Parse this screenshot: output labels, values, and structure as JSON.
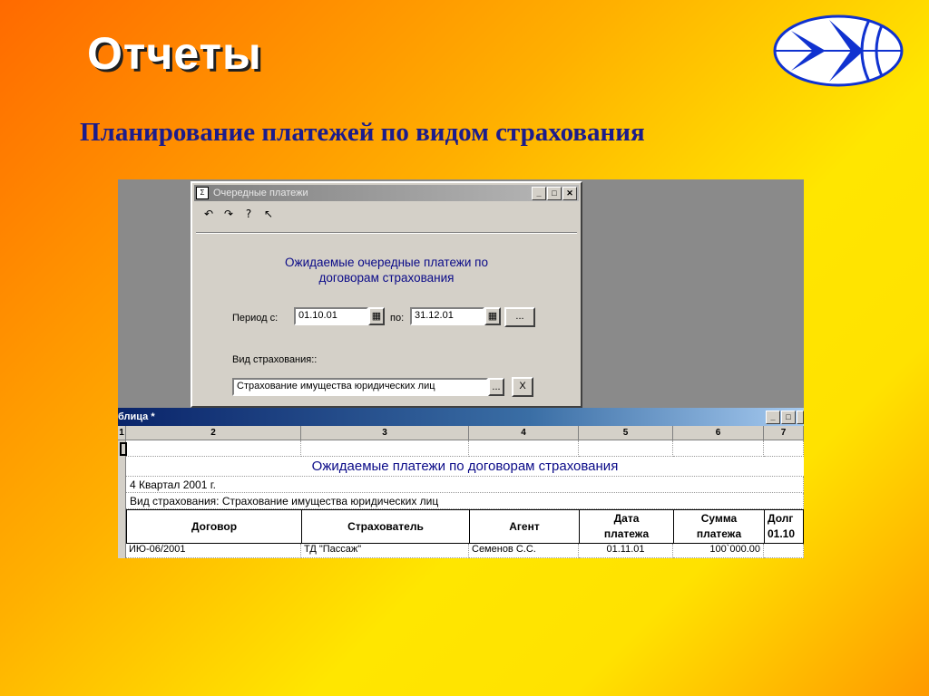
{
  "slide": {
    "title": "Отчеты",
    "subtitle": "Планирование платежей по видом страхования"
  },
  "dialog": {
    "title": "Очередные платежи",
    "heading_line1": "Ожидаемые очередные платежи по",
    "heading_line2": "договорам страхования",
    "period_from_label": "Период с:",
    "period_from_value": "01.10.01",
    "period_to_label": "по:",
    "period_to_value": "31.12.01",
    "ellipsis_button": "...",
    "insurance_type_label": "Вид страхования::",
    "insurance_type_value": "Страхование имущества юридических лиц",
    "select_button": "...",
    "clear_button": "X"
  },
  "table_window": {
    "title": "блица  *",
    "column_numbers": [
      "1",
      "2",
      "3",
      "4",
      "5",
      "6",
      "7"
    ],
    "report_title": "Ожидаемые платежи по договорам страхования",
    "period_line": "4 Квартал 2001 г.",
    "type_line": "Вид страхования: Страхование имущества юридических лиц",
    "headers": [
      "Договор",
      "Страхователь",
      "Агент",
      "Дата платежа",
      "Сумма платежа",
      "Долг 01.10"
    ],
    "rows": [
      [
        "ИЮ-06/2001",
        "ТД \"Пассаж\"",
        "Семенов С.С.",
        "01.11.01",
        "100`000.00",
        ""
      ]
    ]
  },
  "colors": {
    "subtitle": "#1c1c8c",
    "dialog_heading": "#0a0a88",
    "logo_blue": "#1032d0",
    "active_title": "#0a246a"
  }
}
